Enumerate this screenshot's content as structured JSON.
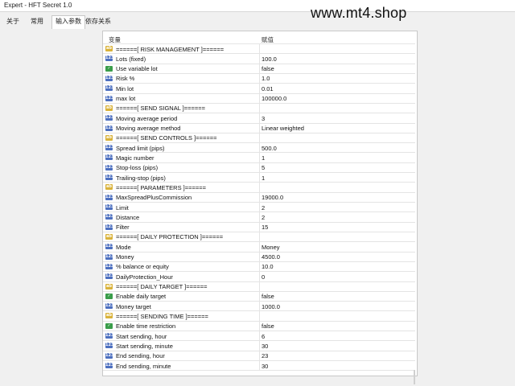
{
  "window": {
    "title": "Expert - HFT Secret 1.0"
  },
  "watermark": "www.mt4.shop",
  "tabs": [
    {
      "label": "关于",
      "active": false
    },
    {
      "label": "常用",
      "active": false
    },
    {
      "label": "输入参数",
      "active": true
    },
    {
      "label": "依存关系",
      "active": false
    }
  ],
  "table": {
    "headers": {
      "variable": "变量",
      "value": "赋值"
    },
    "rows": [
      {
        "icon": "ab",
        "name": "======[ RISK MANAGEMENT ]======",
        "value": ""
      },
      {
        "icon": "num",
        "name": "Lots (fixed)",
        "value": "100.0"
      },
      {
        "icon": "bool",
        "name": "Use variable lot",
        "value": "false"
      },
      {
        "icon": "num",
        "name": "Risk %",
        "value": "1.0"
      },
      {
        "icon": "num",
        "name": "Min lot",
        "value": "0.01"
      },
      {
        "icon": "num",
        "name": "max lot",
        "value": "100000.0"
      },
      {
        "icon": "ab",
        "name": "======[ SEND SIGNAL ]======",
        "value": ""
      },
      {
        "icon": "num",
        "name": "Moving average period",
        "value": "3"
      },
      {
        "icon": "num",
        "name": "Moving average method",
        "value": "Linear weighted"
      },
      {
        "icon": "ab",
        "name": "======[ SEND CONTROLS ]======",
        "value": ""
      },
      {
        "icon": "num",
        "name": "Spread limit (pips)",
        "value": "500.0"
      },
      {
        "icon": "num",
        "name": "Magic number",
        "value": "1"
      },
      {
        "icon": "num",
        "name": "Stop-loss (pips)",
        "value": "5"
      },
      {
        "icon": "num",
        "name": "Trailing-stop (pips)",
        "value": "1"
      },
      {
        "icon": "ab",
        "name": "======[ PARAMETERS ]======",
        "value": ""
      },
      {
        "icon": "num",
        "name": "MaxSpreadPlusCommission",
        "value": "19000.0"
      },
      {
        "icon": "num",
        "name": "Limit",
        "value": "2"
      },
      {
        "icon": "num",
        "name": "Distance",
        "value": "2"
      },
      {
        "icon": "num",
        "name": "Filter",
        "value": "15"
      },
      {
        "icon": "ab",
        "name": "======[ DAILY PROTECTION ]======",
        "value": ""
      },
      {
        "icon": "num",
        "name": "Mode",
        "value": "Money"
      },
      {
        "icon": "num",
        "name": "Money",
        "value": "4500.0"
      },
      {
        "icon": "num",
        "name": "% balance or equity",
        "value": "10.0"
      },
      {
        "icon": "num",
        "name": "DailyProtection_Hour",
        "value": "0"
      },
      {
        "icon": "ab",
        "name": "======[ DAILY TARGET ]======",
        "value": ""
      },
      {
        "icon": "bool",
        "name": "Enable daily target",
        "value": "false"
      },
      {
        "icon": "num",
        "name": "Money target",
        "value": "1000.0"
      },
      {
        "icon": "ab",
        "name": "======[ SENDING TIME ]======",
        "value": ""
      },
      {
        "icon": "bool",
        "name": "Enable time restriction",
        "value": "false"
      },
      {
        "icon": "num",
        "name": "Start sending, hour",
        "value": "6"
      },
      {
        "icon": "num",
        "name": "Start sending, minute",
        "value": "30"
      },
      {
        "icon": "num",
        "name": "End sending, hour",
        "value": "23"
      },
      {
        "icon": "num",
        "name": "End sending, minute",
        "value": "30"
      }
    ]
  },
  "icons": {
    "ab": {
      "glyph": "ab",
      "semantic": "string-param-icon"
    },
    "num": {
      "glyph": "123",
      "semantic": "numeric-param-icon"
    },
    "bool": {
      "glyph": "✓",
      "semantic": "boolean-param-icon"
    }
  }
}
